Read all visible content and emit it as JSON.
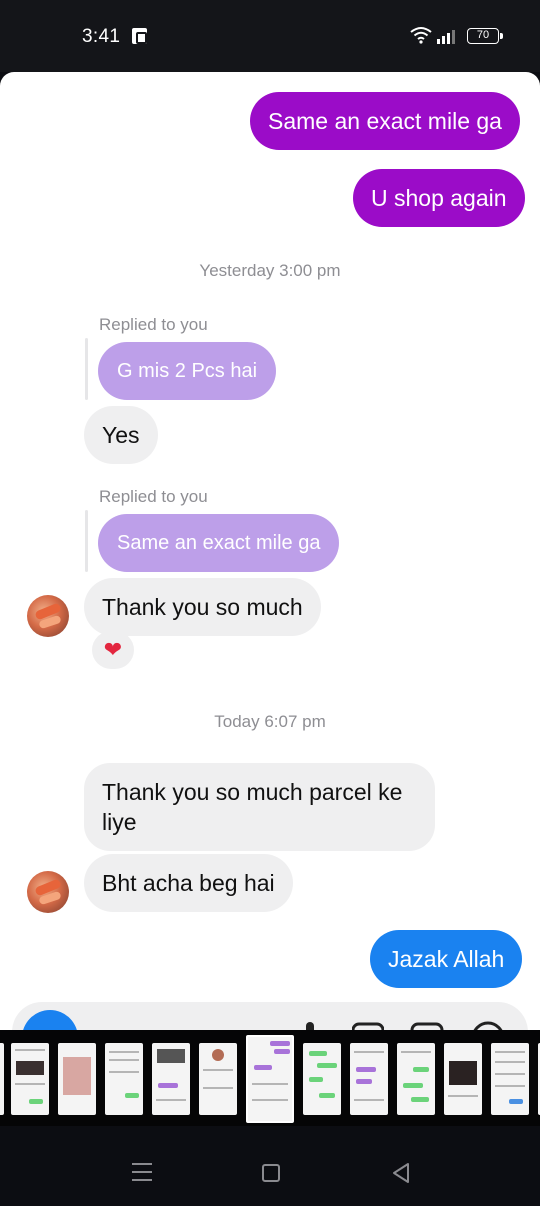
{
  "status_bar": {
    "time": "3:41",
    "battery": "70"
  },
  "messages": [
    {
      "id": "m1",
      "text": "Same an exact mile ga"
    },
    {
      "id": "m2",
      "text": "U shop again"
    },
    {
      "id": "m3",
      "text": "Yes"
    },
    {
      "id": "m4",
      "text": "Thank you so much"
    },
    {
      "id": "m5",
      "text": "Thank you so much parcel ke liye"
    },
    {
      "id": "m6",
      "text": "Bht acha beg hai"
    },
    {
      "id": "m7",
      "text": "Jazak Allah"
    }
  ],
  "timestamps": {
    "yesterday": "Yesterday 3:00 pm",
    "today": "Today 6:07 pm"
  },
  "replies": {
    "label": "Replied to you",
    "quote1": "G mis 2 Pcs hai",
    "quote2": "Same an exact mile ga"
  },
  "reaction": "❤",
  "colors": {
    "outgoing_purple": "#9b0cc8",
    "outgoing_blue": "#1a82f0",
    "incoming_gray": "#efeff0",
    "reply_quote_lavender": "#bd9fe9"
  }
}
